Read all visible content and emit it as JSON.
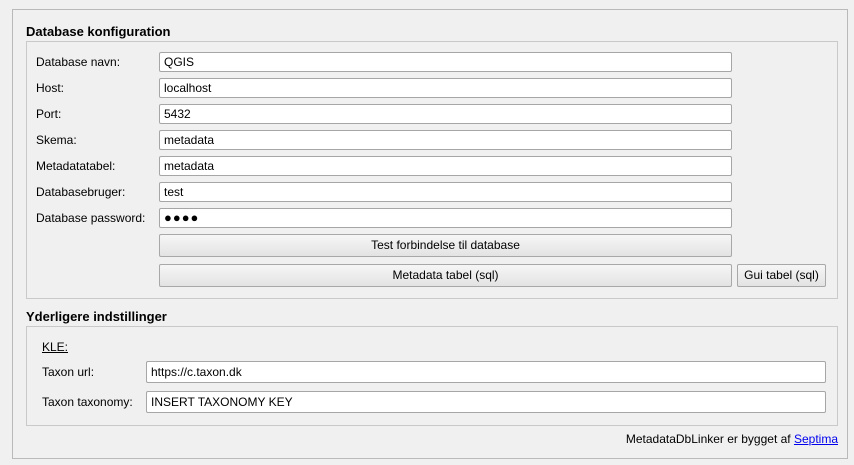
{
  "database": {
    "title": "Database konfiguration",
    "fields": [
      {
        "label": "Database navn:",
        "value": "QGIS"
      },
      {
        "label": "Host:",
        "value": "localhost"
      },
      {
        "label": "Port:",
        "value": "5432"
      },
      {
        "label": "Skema:",
        "value": "metadata"
      },
      {
        "label": "Metadatatabel:",
        "value": "metadata"
      },
      {
        "label": "Databasebruger:",
        "value": "test"
      },
      {
        "label": "Database password:",
        "value": "●●●●"
      }
    ],
    "test_button": "Test forbindelse til database",
    "metadata_sql_button": "Metadata tabel (sql)",
    "gui_sql_button": "Gui tabel (sql)"
  },
  "extra": {
    "title": "Yderligere indstillinger",
    "kle_label": "KLE:",
    "taxon_url_label": "Taxon url:",
    "taxon_url_value": "https://c.taxon.dk",
    "taxon_taxonomy_label": "Taxon taxonomy:",
    "taxon_taxonomy_value": "INSERT TAXONOMY KEY"
  },
  "footer": {
    "text": "MetadataDbLinker er bygget af",
    "link": "Septima"
  }
}
